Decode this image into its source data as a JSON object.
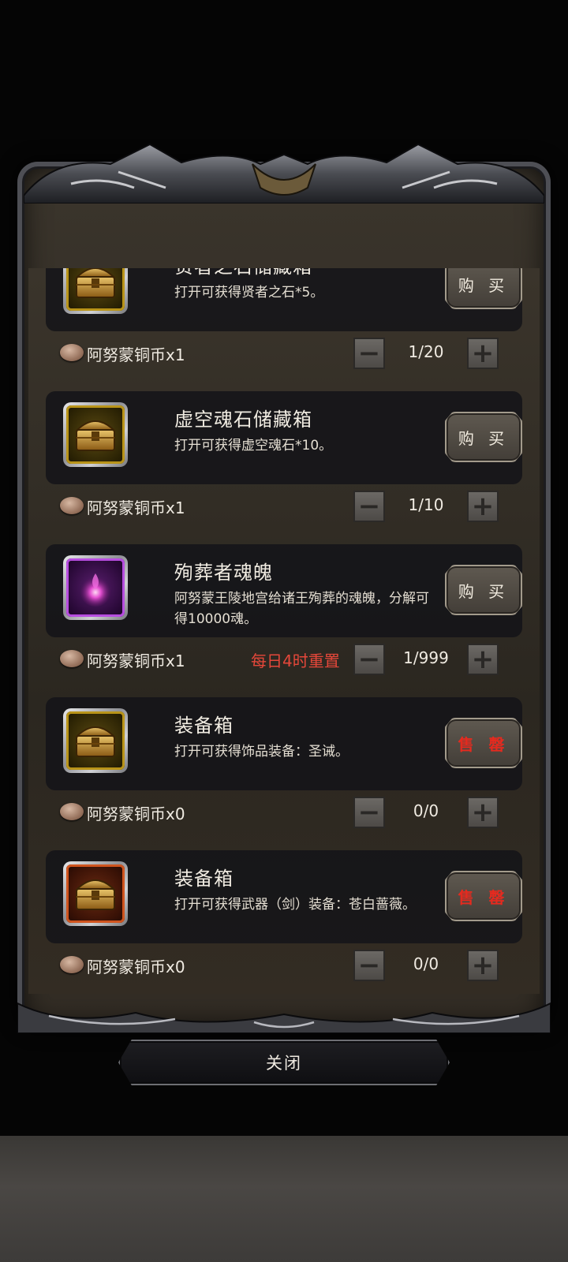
{
  "items": [
    {
      "name": "贤者之石储藏箱",
      "desc": "打开可获得贤者之石*5。",
      "action": "购 买",
      "action_type": "buy",
      "icon": "treasure-chest-icon",
      "slot_color": "gold",
      "price": "阿努蒙铜币x1",
      "note": "",
      "qty": "1/20"
    },
    {
      "name": "虚空魂石储藏箱",
      "desc": "打开可获得虚空魂石*10。",
      "action": "购 买",
      "action_type": "buy",
      "icon": "treasure-chest-icon",
      "slot_color": "gold",
      "price": "阿努蒙铜币x1",
      "note": "",
      "qty": "1/10"
    },
    {
      "name": "殉葬者魂魄",
      "desc": "阿努蒙王陵地宫给诸王殉葬的魂魄，分解可得10000魂。",
      "action": "购 买",
      "action_type": "buy",
      "icon": "soul-orb-icon",
      "slot_color": "purple",
      "price": "阿努蒙铜币x1",
      "note": "每日4时重置",
      "qty": "1/999"
    },
    {
      "name": "装备箱",
      "desc": "打开可获得饰品装备：圣诫。",
      "action": "售 罄",
      "action_type": "sold-out",
      "icon": "treasure-chest-icon",
      "slot_color": "gold",
      "price": "阿努蒙铜币x0",
      "note": "",
      "qty": "0/0"
    },
    {
      "name": "装备箱",
      "desc": "打开可获得武器（剑）装备：苍白蔷薇。",
      "action": "售 罄",
      "action_type": "sold-out",
      "icon": "treasure-chest-icon",
      "slot_color": "red",
      "price": "阿努蒙铜币x0",
      "note": "",
      "qty": "0/0"
    }
  ],
  "controls": {
    "minus": "−",
    "plus": "+"
  },
  "close_label": "关闭",
  "colors": {
    "sold_out": "#e52a1f",
    "reset_note": "#e5473a",
    "gold_border": "#b99419",
    "purple_border": "#b74de0",
    "red_border": "#d0541e"
  }
}
